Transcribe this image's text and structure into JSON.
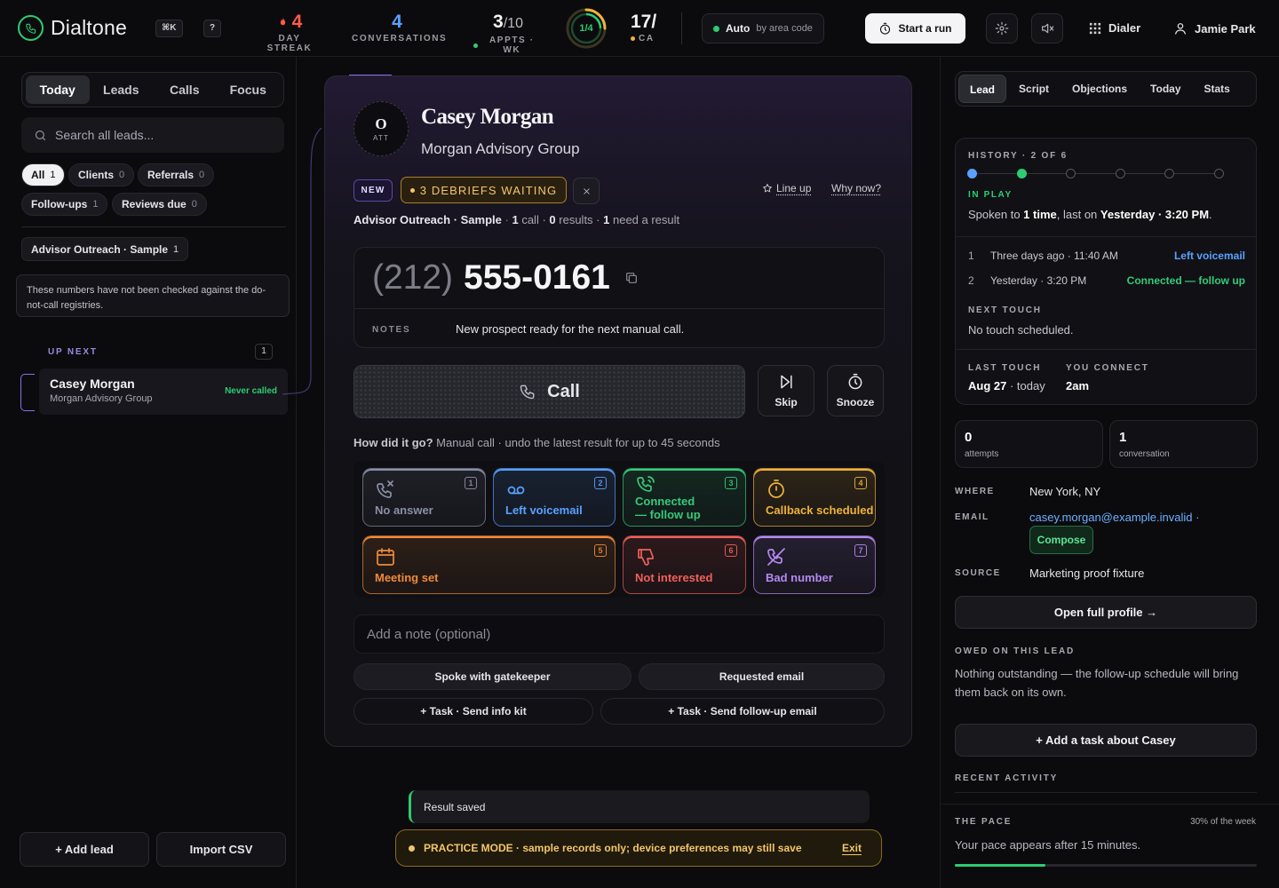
{
  "app": {
    "name": "Dialtone",
    "shortcut_cmd": "⌘K",
    "shortcut_help": "?"
  },
  "topbar": {
    "streak": {
      "value": "4",
      "label": "DAY STREAK"
    },
    "conversations": {
      "value": "4",
      "label": "CONVERSATIONS"
    },
    "appts": {
      "value": "3",
      "total": "/10",
      "label": "APPTS · WK"
    },
    "ring": {
      "label": "1/4",
      "progress": 0.25
    },
    "calls": {
      "value": "17/",
      "label": "CA"
    },
    "auto": {
      "label": "Auto",
      "sub": "by area code"
    },
    "start_run": "Start a run",
    "dialer": "Dialer",
    "user": "Jamie Park"
  },
  "left": {
    "tabs": [
      {
        "label": "Today",
        "active": true
      },
      {
        "label": "Leads",
        "active": false
      },
      {
        "label": "Calls",
        "active": false
      },
      {
        "label": "Focus",
        "active": false
      }
    ],
    "search_placeholder": "Search all leads...",
    "chips": [
      {
        "label": "All",
        "count": "1",
        "active": true
      },
      {
        "label": "Clients",
        "count": "0",
        "active": false
      },
      {
        "label": "Referrals",
        "count": "0",
        "active": false
      },
      {
        "label": "Follow-ups",
        "count": "1",
        "active": false
      },
      {
        "label": "Reviews due",
        "count": "0",
        "active": false
      }
    ],
    "list_chip": {
      "label": "Advisor Outreach · Sample",
      "count": "1"
    },
    "notice": "These numbers have not been checked against the do-not-call registries.",
    "up_next": {
      "label": "UP NEXT",
      "count": "1"
    },
    "lead": {
      "name": "Casey Morgan",
      "company": "Morgan Advisory Group",
      "status": "Never called"
    },
    "add_lead": "+ Add lead",
    "import_csv": "Import CSV"
  },
  "card": {
    "avatar": {
      "big": "O",
      "small": "ATT"
    },
    "name": "Casey Morgan",
    "company": "Morgan Advisory Group",
    "tag_new": "NEW",
    "tag_debriefs": "3 DEBRIEFS WAITING",
    "line_up": "Line up",
    "why_now": "Why now?",
    "meta": {
      "list": "Advisor Outreach · Sample",
      "calls": "1",
      "calls_lbl": "call ·",
      "results": "0",
      "results_lbl": "results ·",
      "need": "1",
      "need_lbl": "need a result"
    },
    "phone": {
      "area": "(212)",
      "number": "555-0161"
    },
    "notes_label": "NOTES",
    "notes": "New prospect ready for the next manual call.",
    "call": "Call",
    "skip": "Skip",
    "snooze": "Snooze",
    "how": {
      "q": "How did it go?",
      "rest": "Manual call · undo the latest result for up to 45 seconds"
    },
    "results": [
      {
        "label": "No answer",
        "key": "1",
        "color": "#8a8fa8"
      },
      {
        "label": "Left voicemail",
        "key": "2",
        "color": "#5aa0ff"
      },
      {
        "label": "Connected\n— follow up",
        "key": "3",
        "color": "#38c97a"
      },
      {
        "label": "Callback scheduled",
        "key": "4",
        "color": "#f0b23a"
      },
      {
        "label": "Meeting set",
        "key": "5",
        "color": "#f08a3a"
      },
      {
        "label": "Not interested",
        "key": "6",
        "color": "#f0605a"
      },
      {
        "label": "Bad number",
        "key": "7",
        "color": "#b58af0"
      }
    ],
    "note_placeholder": "Add a note (optional)",
    "quick": [
      "Spoke with gatekeeper",
      "Requested email"
    ],
    "tasks": [
      "+ Task · Send info kit",
      "+ Task · Send follow-up email"
    ]
  },
  "toast": "Result saved",
  "practice": {
    "text": "PRACTICE MODE · sample records only; device preferences may still save",
    "exit": "Exit"
  },
  "right": {
    "tabs": [
      {
        "label": "Lead",
        "active": true
      },
      {
        "label": "Script",
        "active": false
      },
      {
        "label": "Objections",
        "active": false
      },
      {
        "label": "Today",
        "active": false
      },
      {
        "label": "Stats",
        "active": false
      }
    ],
    "history": {
      "label": "HISTORY · 2 OF 6",
      "status": "IN PLAY",
      "spoken_pre": "Spoken to",
      "spoken_times": "1 time",
      "spoken_mid": ", last on",
      "spoken_last": "Yesterday · 3:20 PM",
      "rows": [
        {
          "i": "1",
          "when": "Three days ago · 11:40 AM",
          "result": "Left voicemail",
          "color": "#5aa0ff"
        },
        {
          "i": "2",
          "when": "Yesterday · 3:20 PM",
          "result": "Connected — follow up",
          "color": "#38c97a"
        }
      ],
      "next_touch_lbl": "NEXT TOUCH",
      "next_touch": "No touch scheduled.",
      "last_touch_lbl": "LAST TOUCH",
      "last_touch_date": "Aug 27",
      "last_touch_rel": "· today",
      "you_connect_lbl": "YOU CONNECT",
      "you_connect": "2am"
    },
    "attempts": {
      "value": "0",
      "label": "attempts"
    },
    "conversation": {
      "value": "1",
      "label": "conversation"
    },
    "where_lbl": "WHERE",
    "where": "New York, NY",
    "email_lbl": "EMAIL",
    "email": "casey.morgan@example.invalid",
    "compose": "Compose",
    "source_lbl": "SOURCE",
    "source": "Marketing proof fixture",
    "open_profile": "Open full profile →",
    "owed_lbl": "OWED ON THIS LEAD",
    "owed": "Nothing outstanding — the follow-up schedule will bring them back on its own.",
    "add_task": "+ Add a task about Casey",
    "recent_lbl": "RECENT ACTIVITY",
    "pace_lbl": "THE PACE",
    "pace_pct": "30% of the week",
    "pace_fraction": 0.3,
    "pace_text": "Your pace appears after 15 minutes."
  }
}
